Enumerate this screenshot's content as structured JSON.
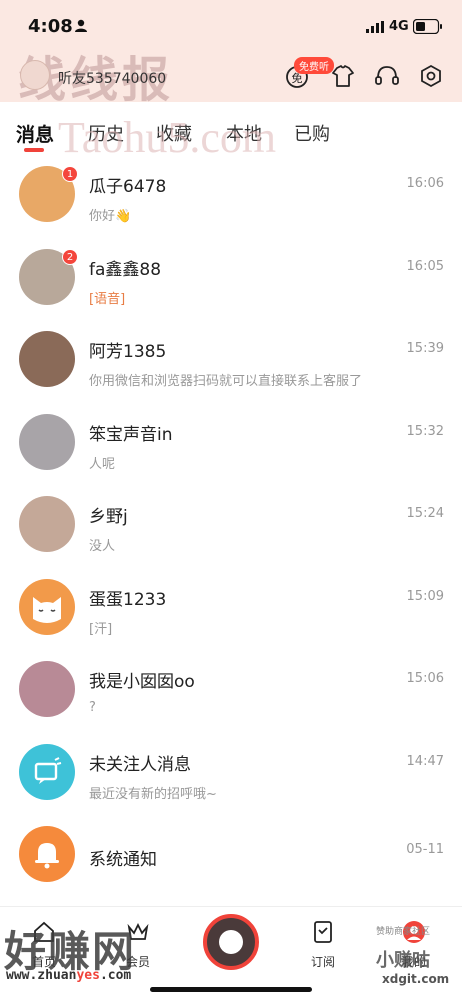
{
  "status_bar": {
    "time": "4:08",
    "network": "4G"
  },
  "watermarks": {
    "top": "线线报",
    "middle": "Taohu5.com",
    "bottom": "好赚网",
    "url_prefix": "www.zhuan",
    "url_accent": "yes",
    "url_suffix": ".com",
    "bottom_right": "小赚咕",
    "bottom_right_url": "xdgit.com",
    "bottom_right_top": "赞助商家社区"
  },
  "header": {
    "account_name": "听友535740060",
    "free_badge": "免费听",
    "icons": [
      "free-listen-icon",
      "tshirt-icon",
      "headset-icon",
      "settings-icon"
    ]
  },
  "tabs": [
    {
      "label": "消息",
      "active": true
    },
    {
      "label": "历史",
      "active": false
    },
    {
      "label": "收藏",
      "active": false
    },
    {
      "label": "本地",
      "active": false
    },
    {
      "label": "已购",
      "active": false
    }
  ],
  "messages": [
    {
      "name": "瓜子6478",
      "preview": "你好👋",
      "time": "16:06",
      "badge": "1",
      "avatar_color": "#e8a866"
    },
    {
      "name": "fa鑫鑫88",
      "preview": "[语音]",
      "time": "16:05",
      "badge": "2",
      "avatar_color": "#b8a89a",
      "preview_style": "orange"
    },
    {
      "name": "阿芳1385",
      "preview": "你用微信和浏览器扫码就可以直接联系上客服了",
      "time": "15:39",
      "avatar_color": "#8a6a58"
    },
    {
      "name": "笨宝声音in",
      "preview": "人呢",
      "time": "15:32",
      "avatar_color": "#a8a4a8"
    },
    {
      "name": "乡野j",
      "preview": "没人",
      "time": "15:24",
      "avatar_color": "#c4a898"
    },
    {
      "name": "蛋蛋1233",
      "preview": "[汗]",
      "time": "15:09",
      "avatar_color": "#f29a4a"
    },
    {
      "name": "我是小囡囡oo",
      "preview": "?",
      "time": "15:06",
      "avatar_color": "#b88a96"
    },
    {
      "name": "未关注人消息",
      "preview": "最近没有新的招呼哦~",
      "time": "14:47",
      "avatar_color": "#3ec2d8"
    },
    {
      "name": "系统通知",
      "preview": "",
      "time": "05-11",
      "avatar_color": "#f58a3c"
    }
  ],
  "bottom_nav": [
    {
      "label": "首页"
    },
    {
      "label": "会员"
    },
    {
      "label": "订阅"
    },
    {
      "label": "我的"
    }
  ]
}
